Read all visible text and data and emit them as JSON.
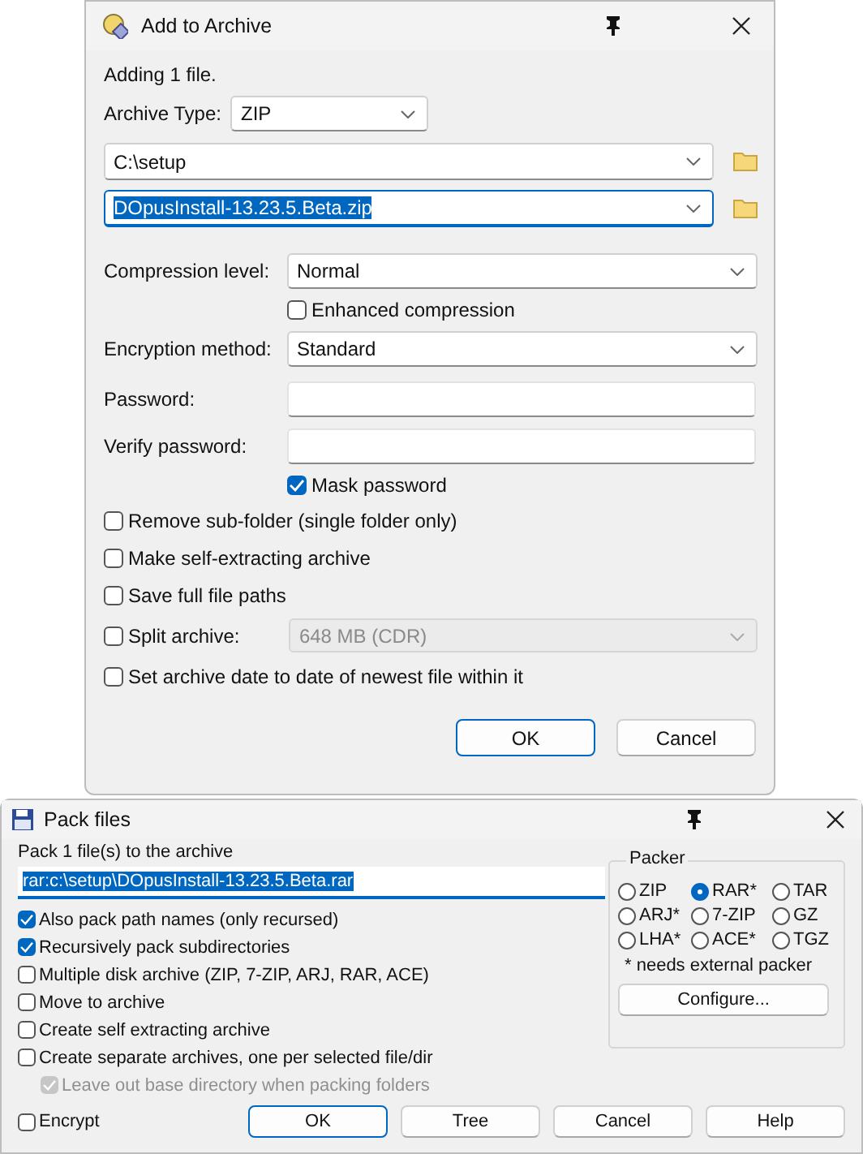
{
  "add_dialog": {
    "title": "Add to Archive",
    "status": "Adding 1 file.",
    "archive_type": {
      "label": "Archive Type:",
      "value": "ZIP"
    },
    "folder": {
      "value": "C:\\setup"
    },
    "filename": {
      "value": "DOpusInstall-13.23.5.Beta.zip",
      "text_selected": true
    },
    "compression": {
      "label": "Compression level:",
      "value": "Normal"
    },
    "enhanced": {
      "label": "Enhanced compression",
      "checked": false
    },
    "encryption": {
      "label": "Encryption method:",
      "value": "Standard"
    },
    "password": {
      "label": "Password:"
    },
    "verify": {
      "label": "Verify password:"
    },
    "mask": {
      "label": "Mask password",
      "checked": true
    },
    "options": [
      {
        "kind": "check",
        "label": "Remove sub-folder (single folder only)",
        "checked": false
      },
      {
        "kind": "check",
        "label": "Make self-extracting archive",
        "checked": false
      },
      {
        "kind": "check",
        "label": "Save full file paths",
        "checked": false
      },
      {
        "kind": "split",
        "label": "Split archive:",
        "checked": false,
        "value": "648 MB (CDR)",
        "disabled": true
      },
      {
        "kind": "check",
        "label": "Set archive date to date of newest file within it",
        "checked": false
      }
    ],
    "buttons": [
      {
        "label": "OK",
        "default": true
      },
      {
        "label": "Cancel",
        "default": false
      }
    ]
  },
  "pack_dialog": {
    "title": "Pack files",
    "prompt": "Pack 1 file(s) to the archive",
    "path": {
      "value": "rar:c:\\setup\\DOpusInstall-13.23.5.Beta.rar",
      "text_selected": true
    },
    "options": [
      {
        "label": "Also pack path names (only recursed)",
        "checked": true,
        "disabled": false
      },
      {
        "label": "Recursively pack subdirectories",
        "checked": true,
        "disabled": false
      },
      {
        "label": "Multiple disk archive (ZIP, 7-ZIP, ARJ, RAR, ACE)",
        "checked": false,
        "disabled": false
      },
      {
        "label": "Move to archive",
        "checked": false,
        "disabled": false
      },
      {
        "label": "Create self extracting archive",
        "checked": false,
        "disabled": false
      },
      {
        "label": "Create separate archives, one per selected file/dir",
        "checked": false,
        "disabled": false,
        "children": [
          {
            "label": "Leave out base directory when packing folders",
            "checked": true,
            "disabled": true
          }
        ]
      }
    ],
    "encrypt": {
      "label": "Encrypt",
      "checked": false
    },
    "packer": {
      "title": "Packer",
      "options": [
        {
          "label": "ZIP",
          "selected": false
        },
        {
          "label": "RAR*",
          "selected": true
        },
        {
          "label": "TAR",
          "selected": false
        },
        {
          "label": "ARJ*",
          "selected": false
        },
        {
          "label": "7-ZIP",
          "selected": false
        },
        {
          "label": "GZ",
          "selected": false
        },
        {
          "label": "LHA*",
          "selected": false
        },
        {
          "label": "ACE*",
          "selected": false
        },
        {
          "label": "TGZ",
          "selected": false
        }
      ],
      "note": "* needs external packer",
      "button": "Configure..."
    },
    "buttons": [
      {
        "label": "OK",
        "default": true
      },
      {
        "label": "Tree",
        "default": false
      },
      {
        "label": "Cancel",
        "default": false
      },
      {
        "label": "Help",
        "default": false
      }
    ]
  }
}
